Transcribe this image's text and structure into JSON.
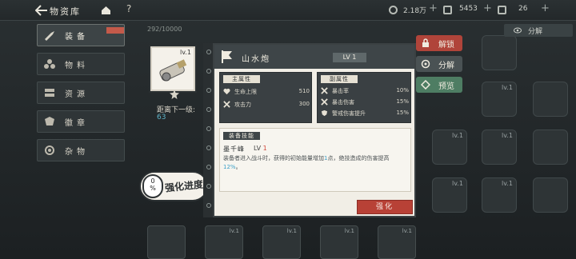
{
  "topbar": {
    "title": "物资库",
    "help": "?",
    "resources": [
      {
        "value": "2.18万"
      },
      {
        "value": "5453"
      },
      {
        "value": "26"
      }
    ]
  },
  "sidebar": {
    "items": [
      {
        "label": "装备",
        "active": true
      },
      {
        "label": "物料"
      },
      {
        "label": "资源"
      },
      {
        "label": "徽章"
      },
      {
        "label": "杂物"
      }
    ]
  },
  "inventory": {
    "count": "292/10000",
    "top_right_action": "分解"
  },
  "item": {
    "level_badge": "lv.1",
    "next_level_label": "距离下一级:",
    "next_level_value": "63",
    "progress_percent": "0",
    "progress_percent_unit": "%",
    "progress_label": "强化进度"
  },
  "card": {
    "name": "山水炮",
    "level": "LV 1",
    "main_stats_header": "主属性",
    "main_stats": [
      {
        "name": "生命上限",
        "value": "510"
      },
      {
        "name": "攻击力",
        "value": "300"
      }
    ],
    "sub_stats_header": "副属性",
    "sub_stats": [
      {
        "name": "暴击率",
        "value": "10%"
      },
      {
        "name": "暴击伤害",
        "value": "15%"
      },
      {
        "name": "警戒伤害提升",
        "value": "15%"
      }
    ],
    "skill_header": "装备技能",
    "skill_name": "墨千峰",
    "skill_level_prefix": "LV",
    "skill_level": "1",
    "skill_desc_1": "装备者进入战斗时，获得的初始能量增加",
    "skill_desc_hl1": "1",
    "skill_desc_2": "点，绝技造成的伤害提高",
    "skill_desc_hl2": "12%",
    "skill_desc_3": "。",
    "enhance_label": "强化"
  },
  "actions": {
    "unlock": "解锁",
    "decompose": "分解",
    "preview": "预览"
  },
  "grid_level": "lv.1",
  "colors": {
    "accent_red": "#b84136",
    "accent_green": "#4e7d63",
    "highlight_blue": "#3da0c9",
    "level_red": "#d0463a"
  }
}
